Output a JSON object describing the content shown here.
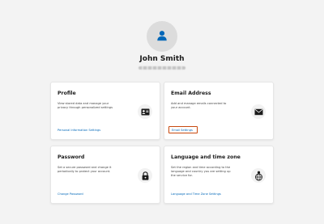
{
  "profile": {
    "name": "John Smith",
    "avatar_icon": "person-icon"
  },
  "cards": {
    "profile": {
      "title": "Profile",
      "description": "View stored data and manage your privacy through personalized settings",
      "link": "Personal Information Settings",
      "icon": "contact-card-icon"
    },
    "email": {
      "title": "Email Address",
      "description": "Add and manage emails connected to your account.",
      "link": "Email Settings",
      "icon": "envelope-icon",
      "highlight_color": "#c8490f"
    },
    "password": {
      "title": "Password",
      "description": "Set a secure password and change it periodically to protect your account.",
      "link": "Change Password",
      "icon": "lock-icon"
    },
    "language": {
      "title": "Language and time zone",
      "description": "Set the region and time according to the language and country you are setting up the service for.",
      "link": "Language and Time Zone Settings",
      "icon": "globe-person-icon"
    }
  },
  "colors": {
    "background": "#f3f3f3",
    "link": "#0067b8",
    "avatar_icon": "#0067b8"
  }
}
